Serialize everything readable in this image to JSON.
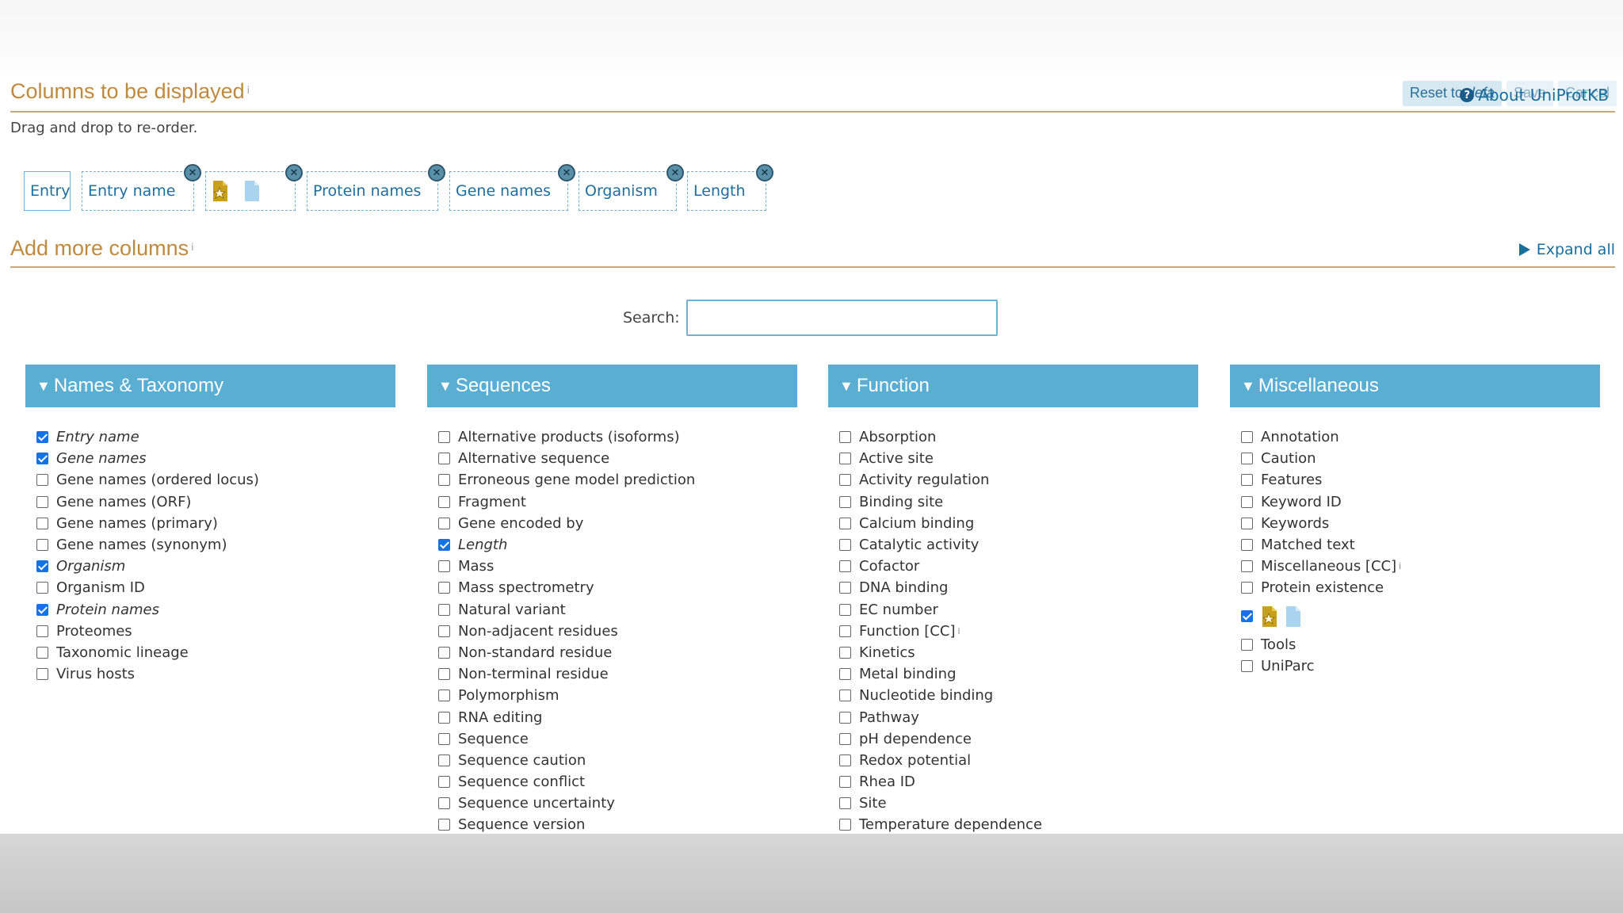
{
  "header": {
    "title": "Columns to be displayed",
    "info_mark": "i",
    "reset_label_prefix": "Reset to ",
    "reset_label_italic": "defa",
    "save_label": "Save",
    "cancel_label": "Cancel",
    "about_label": "About UniProtKB",
    "help_icon": "?"
  },
  "drag_hint": "Drag and drop to re-order.",
  "selected_columns": [
    {
      "label": "Entry",
      "removable": false
    },
    {
      "label": "Entry name",
      "removable": true
    },
    {
      "label": "",
      "icon": "star-document-icon",
      "removable": true
    },
    {
      "label": "Protein names",
      "removable": true
    },
    {
      "label": "Gene names",
      "removable": true
    },
    {
      "label": "Organism",
      "removable": true
    },
    {
      "label": "Length",
      "removable": true
    }
  ],
  "add_section": {
    "title": "Add more columns",
    "info_mark": "i",
    "expand_label": "Expand all"
  },
  "search": {
    "label": "Search:",
    "value": "",
    "placeholder": ""
  },
  "groups": [
    {
      "title": "Names & Taxonomy",
      "items": [
        {
          "label": "Entry name",
          "checked": true
        },
        {
          "label": "Gene names",
          "checked": true
        },
        {
          "label": "Gene names (ordered locus)",
          "checked": false
        },
        {
          "label": "Gene names (ORF)",
          "checked": false
        },
        {
          "label": "Gene names (primary)",
          "checked": false
        },
        {
          "label": "Gene names (synonym)",
          "checked": false
        },
        {
          "label": "Organism",
          "checked": true
        },
        {
          "label": "Organism ID",
          "checked": false
        },
        {
          "label": "Protein names",
          "checked": true
        },
        {
          "label": "Proteomes",
          "checked": false
        },
        {
          "label": "Taxonomic lineage",
          "checked": false
        },
        {
          "label": "Virus hosts",
          "checked": false
        }
      ]
    },
    {
      "title": "Sequences",
      "items": [
        {
          "label": "Alternative products (isoforms)",
          "checked": false
        },
        {
          "label": "Alternative sequence",
          "checked": false
        },
        {
          "label": "Erroneous gene model prediction",
          "checked": false
        },
        {
          "label": "Fragment",
          "checked": false
        },
        {
          "label": "Gene encoded by",
          "checked": false
        },
        {
          "label": "Length",
          "checked": true
        },
        {
          "label": "Mass",
          "checked": false
        },
        {
          "label": "Mass spectrometry",
          "checked": false
        },
        {
          "label": "Natural variant",
          "checked": false
        },
        {
          "label": "Non-adjacent residues",
          "checked": false
        },
        {
          "label": "Non-standard residue",
          "checked": false
        },
        {
          "label": "Non-terminal residue",
          "checked": false
        },
        {
          "label": "Polymorphism",
          "checked": false
        },
        {
          "label": "RNA editing",
          "checked": false
        },
        {
          "label": "Sequence",
          "checked": false
        },
        {
          "label": "Sequence caution",
          "checked": false
        },
        {
          "label": "Sequence conflict",
          "checked": false
        },
        {
          "label": "Sequence uncertainty",
          "checked": false
        },
        {
          "label": "Sequence version",
          "checked": false
        }
      ]
    },
    {
      "title": "Function",
      "items": [
        {
          "label": "Absorption",
          "checked": false
        },
        {
          "label": "Active site",
          "checked": false
        },
        {
          "label": "Activity regulation",
          "checked": false
        },
        {
          "label": "Binding site",
          "checked": false
        },
        {
          "label": "Calcium binding",
          "checked": false
        },
        {
          "label": "Catalytic activity",
          "checked": false
        },
        {
          "label": "Cofactor",
          "checked": false
        },
        {
          "label": "DNA binding",
          "checked": false
        },
        {
          "label": "EC number",
          "checked": false
        },
        {
          "label": "Function [CC]",
          "checked": false,
          "info": "i"
        },
        {
          "label": "Kinetics",
          "checked": false
        },
        {
          "label": "Metal binding",
          "checked": false
        },
        {
          "label": "Nucleotide binding",
          "checked": false
        },
        {
          "label": "Pathway",
          "checked": false
        },
        {
          "label": "pH dependence",
          "checked": false
        },
        {
          "label": "Redox potential",
          "checked": false
        },
        {
          "label": "Rhea ID",
          "checked": false
        },
        {
          "label": "Site",
          "checked": false
        },
        {
          "label": "Temperature dependence",
          "checked": false
        }
      ]
    },
    {
      "title": "Miscellaneous",
      "items": [
        {
          "label": "Annotation",
          "checked": false
        },
        {
          "label": "Caution",
          "checked": false
        },
        {
          "label": "Features",
          "checked": false
        },
        {
          "label": "Keyword ID",
          "checked": false
        },
        {
          "label": "Keywords",
          "checked": false
        },
        {
          "label": "Matched text",
          "checked": false
        },
        {
          "label": "Miscellaneous [CC]",
          "checked": false,
          "info": "i"
        },
        {
          "label": "Protein existence",
          "checked": false
        },
        {
          "label": "",
          "checked": true,
          "icon": "star-document-icon"
        },
        {
          "label": "Tools",
          "checked": false
        },
        {
          "label": "UniParc",
          "checked": false
        }
      ]
    }
  ],
  "colors": {
    "accent_blue": "#5aaed2",
    "title_orange": "#c08a3e",
    "link_blue": "#1a6e9e",
    "check_blue": "#1473e6"
  }
}
